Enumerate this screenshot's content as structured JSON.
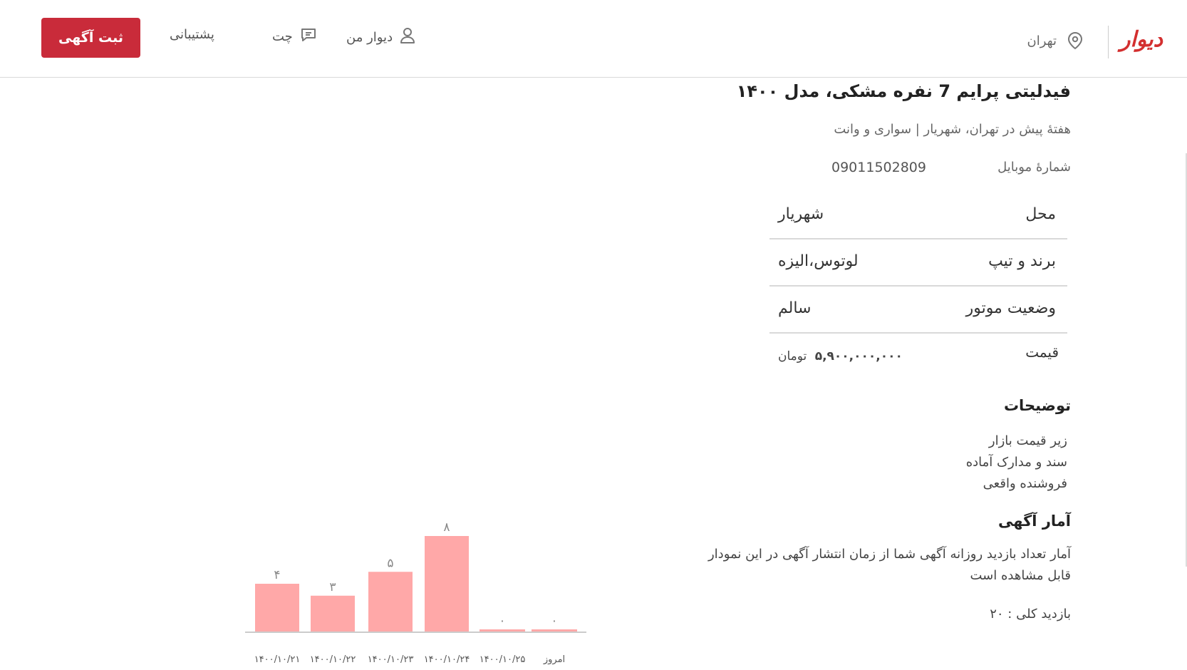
{
  "header": {
    "logo": "دیوار",
    "city": "تهران",
    "post_button": "ثبت آگهی",
    "support": "پشتیبانی",
    "chat": "چت",
    "my_divar": "دیوار من"
  },
  "ad": {
    "title": "فیدلیتی پرایم 7 نفره مشکی، مدل ۱۴۰۰",
    "subtitle": "هفتهٔ پیش در تهران، شهریار | سواری و وانت",
    "phone_label": "شمارهٔ موبایل",
    "phone_value": "09011502809"
  },
  "attributes": [
    {
      "key": "محل",
      "value": "شهریار"
    },
    {
      "key": "برند و تیپ",
      "value": "لوتوس،الیزه"
    },
    {
      "key": "وضعیت موتور",
      "value": "سالم"
    }
  ],
  "price": {
    "label": "قیمت",
    "amount": "۵,۹۰۰,۰۰۰,۰۰۰",
    "currency": "تومان"
  },
  "description": {
    "title": "توضیحات",
    "lines": [
      "زیر قیمت بازار",
      "سند و مدارک آماده",
      "فروشنده واقعی"
    ]
  },
  "stats": {
    "title": "آمار آگهی",
    "text": "آمار تعداد بازدید روزانه آگهی شما از زمان انتشار آگهی در این نمودار قابل مشاهده است",
    "total": "بازدید کلی : ۲۰"
  },
  "colors": {
    "accent": "#c92b3a",
    "bar": "#ffa8a8"
  },
  "chart_data": {
    "type": "bar",
    "categories": [
      "۱۴۰۰/۱۰/۲۱",
      "۱۴۰۰/۱۰/۲۲",
      "۱۴۰۰/۱۰/۲۳",
      "۱۴۰۰/۱۰/۲۴",
      "۱۴۰۰/۱۰/۲۵",
      "امروز"
    ],
    "values": [
      4,
      3,
      5,
      8,
      0,
      0
    ],
    "value_labels": [
      "۴",
      "۳",
      "۵",
      "۸",
      "۰",
      "۰"
    ],
    "ylim": [
      0,
      8
    ],
    "grid": false
  }
}
